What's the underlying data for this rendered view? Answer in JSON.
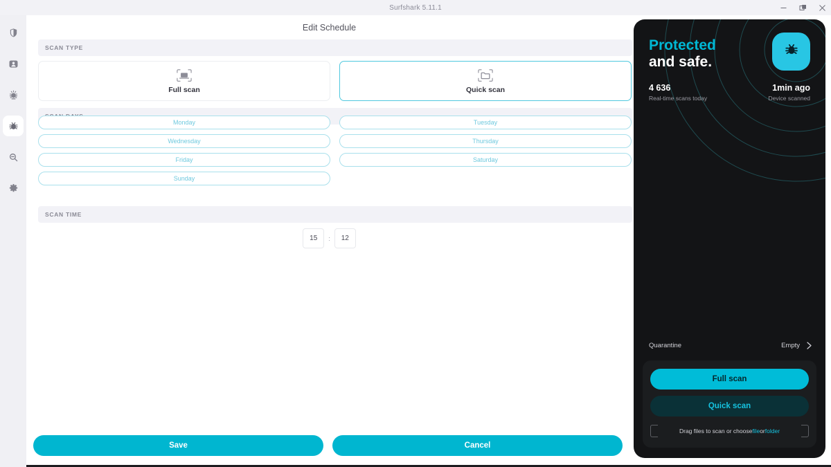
{
  "window": {
    "title": "Surfshark 5.11.1",
    "controls": [
      {
        "name": "minimize",
        "glyph": "minimize-icon"
      },
      {
        "name": "maximize",
        "glyph": "restore-icon"
      },
      {
        "name": "close",
        "glyph": "close-icon"
      }
    ]
  },
  "sidebar": {
    "items": [
      {
        "icon": "shield-icon",
        "name": "sidebar-item-vpn",
        "active": false
      },
      {
        "icon": "id-card-icon",
        "name": "sidebar-item-alternative-id",
        "active": false
      },
      {
        "icon": "alert-bug-icon",
        "name": "sidebar-item-alert",
        "active": false
      },
      {
        "icon": "bug-icon",
        "name": "sidebar-item-antivirus",
        "active": true
      },
      {
        "icon": "search-icon",
        "name": "sidebar-item-search",
        "active": false
      },
      {
        "icon": "gear-icon",
        "name": "sidebar-item-settings",
        "active": false
      }
    ]
  },
  "main": {
    "page_title": "Edit Schedule",
    "scan_type": {
      "section_label": "SCAN TYPE",
      "options": [
        {
          "label": "Full scan",
          "icon": "scan-laptop-icon",
          "selected": false
        },
        {
          "label": "Quick scan",
          "icon": "scan-folder-icon",
          "selected": true
        }
      ]
    },
    "scan_days": {
      "section_label": "SCAN DAYS",
      "days": [
        {
          "label": "Monday"
        },
        {
          "label": "Tuesday"
        },
        {
          "label": "Wednesday"
        },
        {
          "label": "Thursday"
        },
        {
          "label": "Friday"
        },
        {
          "label": "Saturday"
        },
        {
          "label": "Sunday"
        }
      ]
    },
    "scan_time": {
      "section_label": "SCAN TIME",
      "hours": "15",
      "separator": ":",
      "minutes": "12"
    },
    "footer": {
      "save_label": "Save",
      "cancel_label": "Cancel"
    }
  },
  "panel": {
    "status_line1": "Protected",
    "status_line2": "and safe.",
    "badge_icon": "bug-icon",
    "stats": [
      {
        "value": "4 636",
        "label": "Real-time scans today"
      },
      {
        "value": "1min ago",
        "label": "Device scanned"
      }
    ],
    "quarantine": {
      "label": "Quarantine",
      "value": "Empty",
      "chevron": "chevron-right-icon"
    },
    "actions": {
      "full_scan": "Full scan",
      "quick_scan": "Quick scan",
      "dropzone_prefix": "Drag files to scan or choose ",
      "dropzone_file": "file",
      "dropzone_or": " or ",
      "dropzone_folder": "folder"
    }
  },
  "colors": {
    "accent": "#00b6d0",
    "accent_bright": "#28c6e4",
    "panel_bg": "#131416",
    "page_bg": "#f2f2f6",
    "day_border": "#a9e0ec",
    "day_text": "#6fc9de"
  }
}
